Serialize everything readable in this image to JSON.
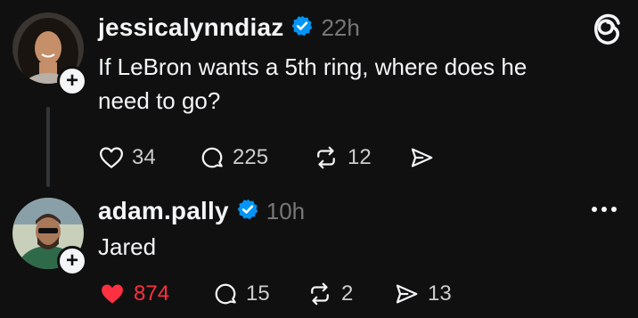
{
  "posts": [
    {
      "username": "jessicalynndiaz",
      "time": "22h",
      "text_line1": "If LeBron wants a 5th ring, where does he",
      "text_line2": "need to go?",
      "likes": "34",
      "replies": "225",
      "reposts": "12"
    },
    {
      "username": "adam.pally",
      "time": "10h",
      "text": "Jared",
      "likes": "874",
      "replies": "15",
      "reposts": "2",
      "shares": "13"
    }
  ],
  "colors": {
    "background": "#101010",
    "verified": "#0095f6",
    "liked": "#ff3040",
    "muted": "#777777"
  },
  "icons": [
    "threads-logo-icon",
    "verified-badge-icon",
    "heart-icon",
    "reply-icon",
    "repost-icon",
    "share-icon",
    "more-icon",
    "follow-plus-icon"
  ]
}
